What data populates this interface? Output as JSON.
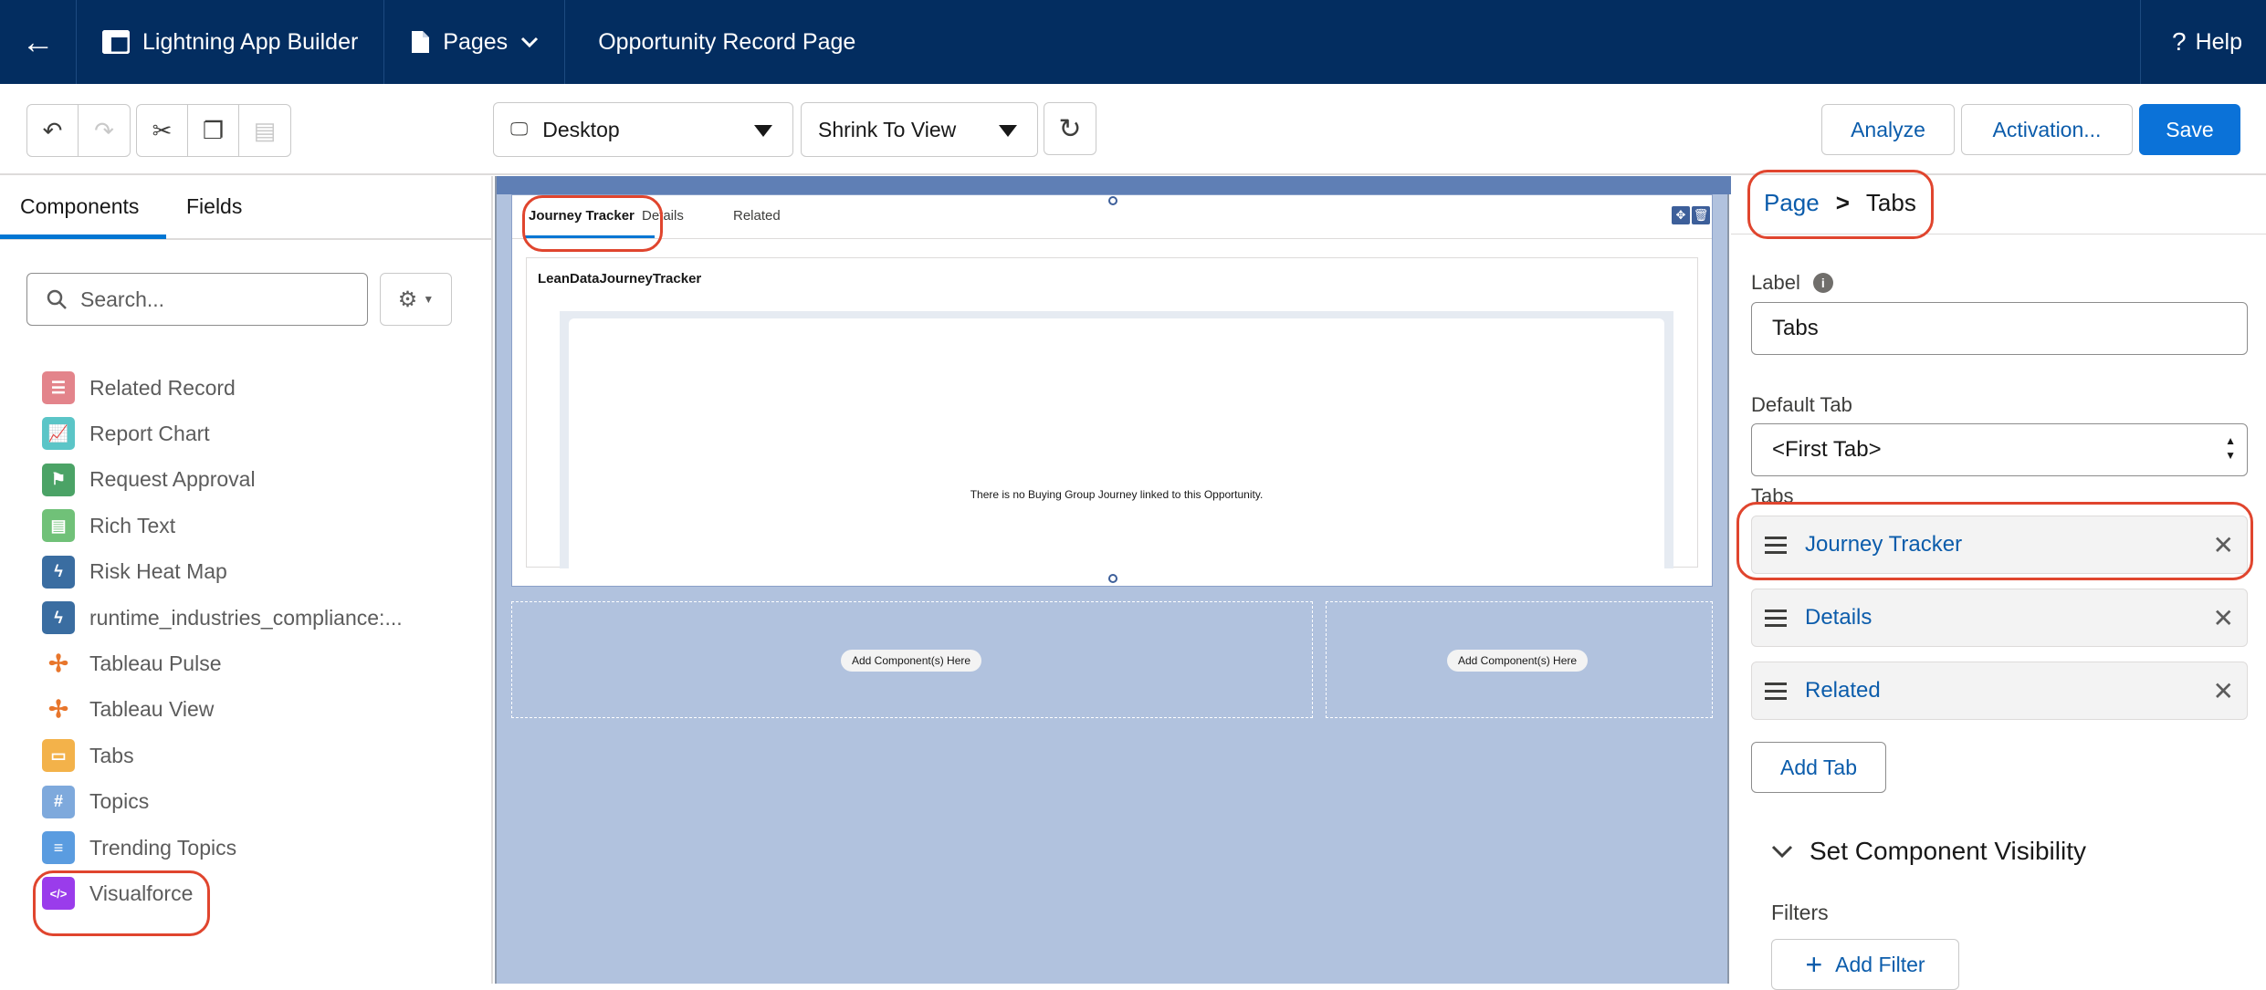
{
  "topbar": {
    "app_name": "Lightning App Builder",
    "pages_label": "Pages",
    "page_title": "Opportunity Record Page",
    "help_label": "Help"
  },
  "toolbar": {
    "device": "Desktop",
    "zoom": "Shrink To View",
    "analyze_label": "Analyze",
    "activation_label": "Activation...",
    "save_label": "Save"
  },
  "left_panel": {
    "tabs": [
      "Components",
      "Fields"
    ],
    "search_placeholder": "Search...",
    "components": [
      {
        "label": "Related Record",
        "icon": "record-icon",
        "color": "#e3848b"
      },
      {
        "label": "Report Chart",
        "icon": "chart-icon",
        "color": "#5bc5c7"
      },
      {
        "label": "Request Approval",
        "icon": "approval-icon",
        "color": "#4ba366"
      },
      {
        "label": "Rich Text",
        "icon": "rich-text-icon",
        "color": "#70c178"
      },
      {
        "label": "Risk Heat Map",
        "icon": "lightning-icon",
        "color": "#3a6da1"
      },
      {
        "label": "runtime_industries_compliance:...",
        "icon": "lightning-icon",
        "color": "#3a6da1"
      },
      {
        "label": "Tableau Pulse",
        "icon": "tableau-icon",
        "color": "#ffffff"
      },
      {
        "label": "Tableau View",
        "icon": "tableau-icon",
        "color": "#ffffff"
      },
      {
        "label": "Tabs",
        "icon": "tabs-icon",
        "color": "#f3b24a"
      },
      {
        "label": "Topics",
        "icon": "hash-icon",
        "color": "#7ea9dc"
      },
      {
        "label": "Trending Topics",
        "icon": "list-icon",
        "color": "#5a9ce0"
      },
      {
        "label": "Visualforce",
        "icon": "code-icon",
        "color": "#9a3ceb"
      }
    ]
  },
  "canvas": {
    "tabs": [
      "Journey Tracker",
      "Details",
      "Related"
    ],
    "component_title": "LeanDataJourneyTracker",
    "empty_message": "There is no Buying Group Journey linked to this Opportunity.",
    "add_component_label": "Add Component(s) Here"
  },
  "right_panel": {
    "breadcrumb_page": "Page",
    "breadcrumb_sep": ">",
    "breadcrumb_current": "Tabs",
    "label_field_label": "Label",
    "label_field_value": "Tabs",
    "default_tab_label": "Default Tab",
    "default_tab_value": "<First Tab>",
    "tabs_label": "Tabs",
    "tab_items": [
      "Journey Tracker",
      "Details",
      "Related"
    ],
    "add_tab_label": "Add Tab",
    "visibility_label": "Set Component Visibility",
    "filters_label": "Filters",
    "add_filter_label": "Add Filter"
  },
  "colors": {
    "header_bg": "#032d60",
    "accent": "#0176d3",
    "annotation": "#e0452e",
    "canvas_bg": "#b1c2de"
  }
}
